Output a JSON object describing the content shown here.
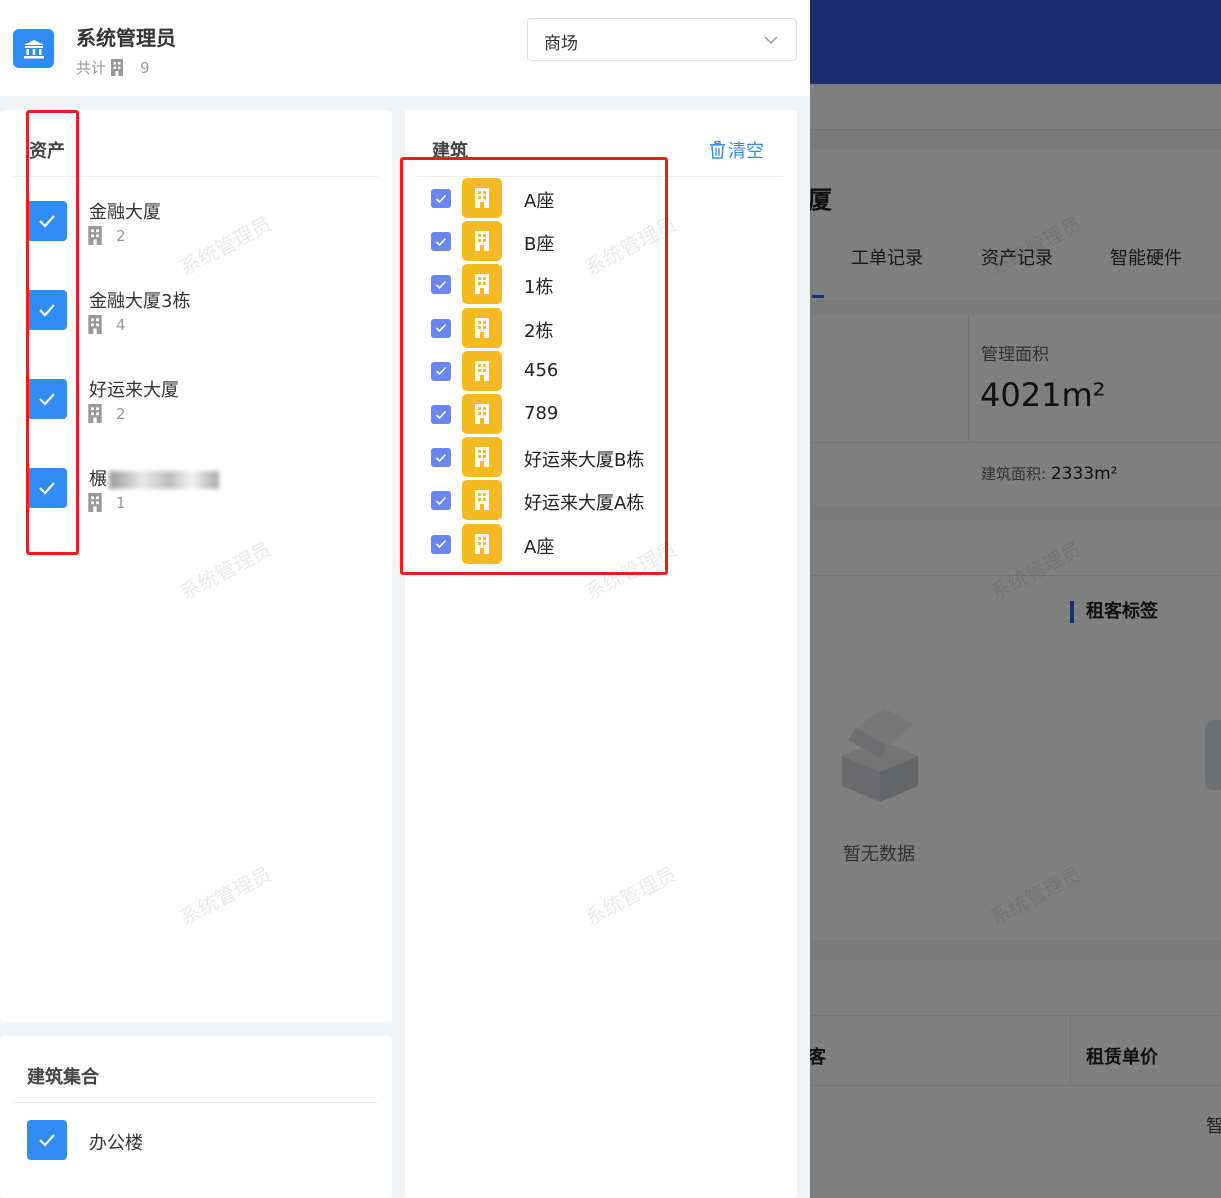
{
  "user": {
    "name": "系统管理员",
    "total_label": "共计",
    "total_count": "9"
  },
  "select": {
    "value": "商场"
  },
  "assets": {
    "title": "资产",
    "items": [
      {
        "name": "金融大厦",
        "count": "2",
        "redacted": false
      },
      {
        "name": "金融大厦3栋",
        "count": "4",
        "redacted": false
      },
      {
        "name": "好运来大厦",
        "count": "2",
        "redacted": false
      },
      {
        "name": "榐",
        "name_suffix": "",
        "count": "1",
        "redacted": true
      }
    ]
  },
  "buildings": {
    "title": "建筑",
    "clear_label": "清空",
    "items": [
      "A座",
      "B座",
      "1栋",
      "2栋",
      "456",
      "789",
      "好运来大厦B栋",
      "好运来大厦A栋",
      "A座"
    ]
  },
  "group": {
    "title": "建筑集合",
    "items": [
      "办公楼"
    ]
  },
  "background": {
    "card_title": "厦",
    "tabs": [
      "工单记录",
      "资产记录",
      "智能硬件"
    ],
    "stat_label": "管理面积",
    "stat_value": "4021",
    "stat_unit": "m²",
    "stat_sub_label": "建筑面积:",
    "stat_sub_value": "2333m²",
    "tag_title": "租客标签",
    "empty_text": "暂无数据",
    "table_col1": "客",
    "table_col2": "租赁单价",
    "cut_text": "智"
  },
  "watermark": "系统管理员",
  "colors": {
    "accent": "#2f8cf3",
    "building_icon": "#f5b922",
    "highlight": "#f01c1c",
    "checkbox": "#6b86ee"
  }
}
